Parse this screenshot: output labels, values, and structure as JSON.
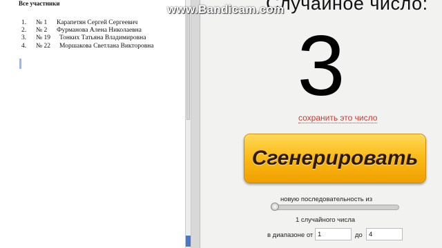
{
  "document": {
    "title": "Все участники",
    "participants": [
      {
        "index": "1.",
        "number": "№ 1",
        "name": "Карапетян Сергей Сергеевич"
      },
      {
        "index": "2.",
        "number": "№ 2",
        "name": "Фурманова Алена Николаевна"
      },
      {
        "index": "3.",
        "number": "№ 19",
        "name": "Тонких Татьяна Владимировна"
      },
      {
        "index": "4.",
        "number": "№ 22",
        "name": "Моршакова Светлана Викторовна"
      }
    ]
  },
  "random": {
    "title": "Случайное число:",
    "result": "3",
    "save_link": "сохранить это число",
    "generate_button": "Сгенерировать",
    "sequence_label": "новую последовательность из",
    "count_label": "1 случайного числа",
    "range_from_label": "в диапазоне от",
    "range_to_label": "до",
    "range_from": "1",
    "range_to": "4"
  },
  "watermark": "www.Bandicam.com",
  "colors": {
    "button": "#fbbc1a",
    "link": "#c83a2b"
  }
}
